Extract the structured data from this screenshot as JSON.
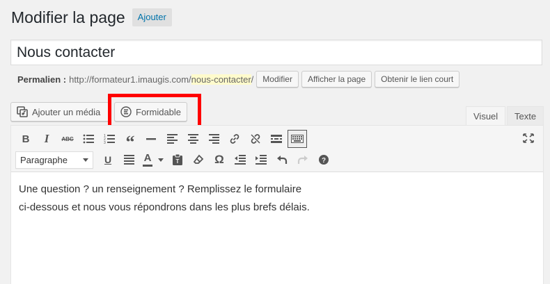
{
  "header": {
    "title": "Modifier la page",
    "add_new_label": "Ajouter"
  },
  "title_field": {
    "value": "Nous contacter"
  },
  "permalink": {
    "label": "Permalien :",
    "base_url": "http://formateur1.imaugis.com/",
    "slug": "nous-contacter",
    "trailing": "/",
    "buttons": [
      "Modifier",
      "Afficher la page",
      "Obtenir le lien court"
    ]
  },
  "media_buttons": {
    "add_media": "Ajouter un média",
    "formidable": "Formidable"
  },
  "tabs": {
    "visual": "Visuel",
    "text": "Texte",
    "active": "Visuel"
  },
  "toolbar": {
    "row1": [
      "bold-icon",
      "italic-icon",
      "strikethrough-icon",
      "bullet-list-icon",
      "numbered-list-icon",
      "blockquote-icon",
      "horizontal-rule-icon",
      "align-left-icon",
      "align-center-icon",
      "align-right-icon",
      "link-icon",
      "unlink-icon",
      "read-more-icon",
      "toolbar-toggle-icon"
    ],
    "row2": [
      "underline-icon",
      "justify-icon",
      "text-color-icon",
      "paste-text-icon",
      "clear-formatting-icon",
      "special-character-icon",
      "outdent-icon",
      "indent-icon",
      "undo-icon",
      "redo-icon",
      "help-icon"
    ],
    "format_select": "Paragraphe",
    "fullscreen": "fullscreen-icon"
  },
  "editor_content": {
    "line1": "Une question ? un renseignement ? Remplissez le formulaire",
    "line2": "ci-dessous et nous vous répondrons dans les plus brefs délais."
  },
  "colors": {
    "highlight": "#ff0000",
    "link": "#0073aa",
    "slug_bg": "#fffbcc"
  }
}
